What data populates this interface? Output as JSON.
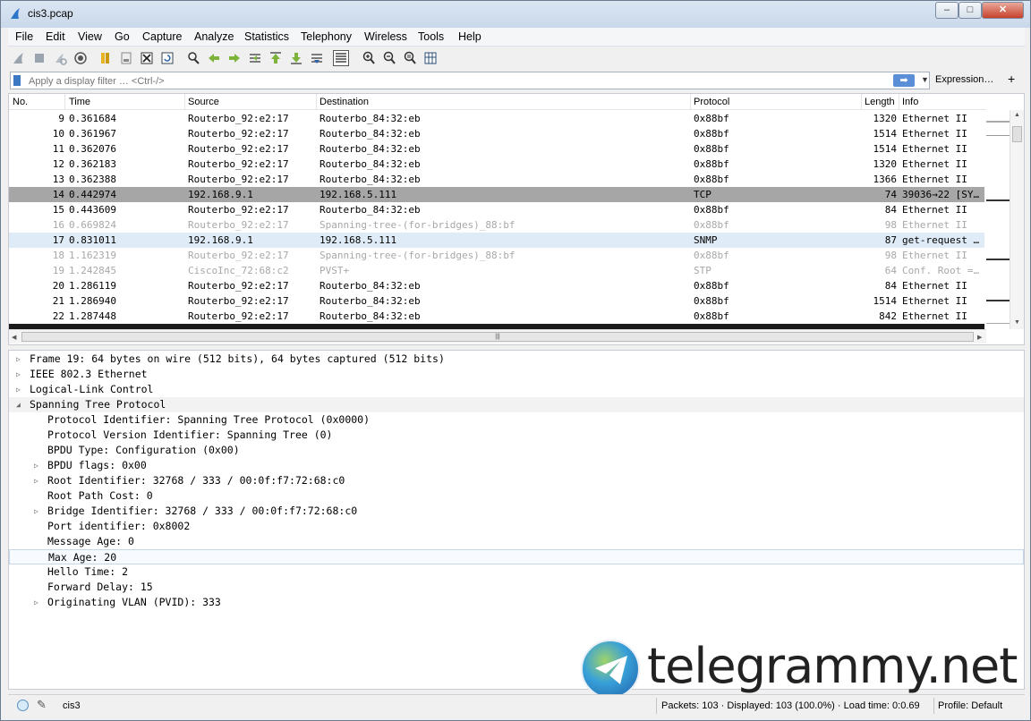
{
  "window": {
    "title": "cis3.pcap",
    "min": "–",
    "max": "□",
    "close": "✕"
  },
  "menu": [
    "File",
    "Edit",
    "View",
    "Go",
    "Capture",
    "Analyze",
    "Statistics",
    "Telephony",
    "Wireless",
    "Tools",
    "Help"
  ],
  "toolbar": {
    "icons": [
      "start-capture-icon",
      "stop-capture-icon",
      "restart-capture-icon",
      "capture-options-icon",
      "open-file-icon",
      "save-file-icon",
      "close-file-icon",
      "reload-file-icon",
      "find-packet-icon",
      "go-back-icon",
      "go-forward-icon",
      "go-to-packet-icon",
      "go-first-icon",
      "go-last-icon",
      "autoscroll-icon",
      "colorize-icon",
      "zoom-in-icon",
      "zoom-out-icon",
      "zoom-normal-icon",
      "resize-columns-icon"
    ]
  },
  "filter": {
    "placeholder": "Apply a display filter … <Ctrl-/>",
    "apply_glyph": "➡",
    "dropdown_glyph": "▼",
    "expression_label": "Expression…",
    "add_glyph": "+"
  },
  "packet_list": {
    "columns": [
      "No.",
      "Time",
      "Source",
      "Destination",
      "Protocol",
      "Length",
      "Info"
    ],
    "rows": [
      {
        "no": "9",
        "time": "0.361684",
        "src": "Routerbo_92:e2:17",
        "dst": "Routerbo_84:32:eb",
        "proto": "0x88bf",
        "len": "1320",
        "info": "Ethernet II",
        "style": "normal"
      },
      {
        "no": "10",
        "time": "0.361967",
        "src": "Routerbo_92:e2:17",
        "dst": "Routerbo_84:32:eb",
        "proto": "0x88bf",
        "len": "1514",
        "info": "Ethernet II",
        "style": "normal"
      },
      {
        "no": "11",
        "time": "0.362076",
        "src": "Routerbo_92:e2:17",
        "dst": "Routerbo_84:32:eb",
        "proto": "0x88bf",
        "len": "1514",
        "info": "Ethernet II",
        "style": "normal"
      },
      {
        "no": "12",
        "time": "0.362183",
        "src": "Routerbo_92:e2:17",
        "dst": "Routerbo_84:32:eb",
        "proto": "0x88bf",
        "len": "1320",
        "info": "Ethernet II",
        "style": "normal"
      },
      {
        "no": "13",
        "time": "0.362388",
        "src": "Routerbo_92:e2:17",
        "dst": "Routerbo_84:32:eb",
        "proto": "0x88bf",
        "len": "1366",
        "info": "Ethernet II",
        "style": "normal"
      },
      {
        "no": "14",
        "time": "0.442974",
        "src": "192.168.9.1",
        "dst": "192.168.5.111",
        "proto": "TCP",
        "len": "74",
        "info": "39036→22 [SY…",
        "style": "selected"
      },
      {
        "no": "15",
        "time": "0.443609",
        "src": "Routerbo_92:e2:17",
        "dst": "Routerbo_84:32:eb",
        "proto": "0x88bf",
        "len": "84",
        "info": "Ethernet II",
        "style": "normal"
      },
      {
        "no": "16",
        "time": "0.669824",
        "src": "Routerbo_92:e2:17",
        "dst": "Spanning-tree-(for-bridges)_88:bf",
        "proto": "0x88bf",
        "len": "98",
        "info": "Ethernet II",
        "style": "faded"
      },
      {
        "no": "17",
        "time": "0.831011",
        "src": "192.168.9.1",
        "dst": "192.168.5.111",
        "proto": "SNMP",
        "len": "87",
        "info": "get-request …",
        "style": "snmp"
      },
      {
        "no": "18",
        "time": "1.162319",
        "src": "Routerbo_92:e2:17",
        "dst": "Spanning-tree-(for-bridges)_88:bf",
        "proto": "0x88bf",
        "len": "98",
        "info": "Ethernet II",
        "style": "faded"
      },
      {
        "no": "19",
        "time": "1.242845",
        "src": "CiscoInc_72:68:c2",
        "dst": "PVST+",
        "proto": "STP",
        "len": "64",
        "info": "Conf. Root =…",
        "style": "faded"
      },
      {
        "no": "20",
        "time": "1.286119",
        "src": "Routerbo_92:e2:17",
        "dst": "Routerbo_84:32:eb",
        "proto": "0x88bf",
        "len": "84",
        "info": "Ethernet II",
        "style": "normal"
      },
      {
        "no": "21",
        "time": "1.286940",
        "src": "Routerbo_92:e2:17",
        "dst": "Routerbo_84:32:eb",
        "proto": "0x88bf",
        "len": "1514",
        "info": "Ethernet II",
        "style": "normal"
      },
      {
        "no": "22",
        "time": "1.287448",
        "src": "Routerbo_92:e2:17",
        "dst": "Routerbo_84:32:eb",
        "proto": "0x88bf",
        "len": "842",
        "info": "Ethernet II",
        "style": "normal"
      }
    ],
    "hscroll_grip": "|||"
  },
  "details": {
    "rows": [
      {
        "text": "Frame 19: 64 bytes on wire (512 bits), 64 bytes captured (512 bits)",
        "level": 0,
        "toggle": "closed"
      },
      {
        "text": "IEEE 802.3 Ethernet",
        "level": 0,
        "toggle": "closed"
      },
      {
        "text": "Logical-Link Control",
        "level": 0,
        "toggle": "closed"
      },
      {
        "text": "Spanning Tree Protocol",
        "level": 0,
        "toggle": "open"
      },
      {
        "text": "Protocol Identifier: Spanning Tree Protocol (0x0000)",
        "level": 1,
        "toggle": "none"
      },
      {
        "text": "Protocol Version Identifier: Spanning Tree (0)",
        "level": 1,
        "toggle": "none"
      },
      {
        "text": "BPDU Type: Configuration (0x00)",
        "level": 1,
        "toggle": "none"
      },
      {
        "text": "BPDU flags: 0x00",
        "level": 1,
        "toggle": "closed"
      },
      {
        "text": "Root Identifier: 32768 / 333 / 00:0f:f7:72:68:c0",
        "level": 1,
        "toggle": "closed"
      },
      {
        "text": "Root Path Cost: 0",
        "level": 1,
        "toggle": "none"
      },
      {
        "text": "Bridge Identifier: 32768 / 333 / 00:0f:f7:72:68:c0",
        "level": 1,
        "toggle": "closed"
      },
      {
        "text": "Port identifier: 0x8002",
        "level": 1,
        "toggle": "none"
      },
      {
        "text": "Message Age: 0",
        "level": 1,
        "toggle": "none"
      },
      {
        "text": "Max Age: 20",
        "level": 1,
        "toggle": "none",
        "focused": true
      },
      {
        "text": "Hello Time: 2",
        "level": 1,
        "toggle": "none"
      },
      {
        "text": "Forward Delay: 15",
        "level": 1,
        "toggle": "none"
      },
      {
        "text": "Originating VLAN (PVID): 333",
        "level": 1,
        "toggle": "closed"
      }
    ]
  },
  "watermark": {
    "text": "telegrammy.net"
  },
  "status": {
    "file": "cis3",
    "stats": "Packets: 103 · Displayed: 103 (100.0%) · Load time: 0:0.69",
    "profile": "Profile: Default"
  },
  "colors": {
    "selected_row": "#a6a6a6",
    "snmp_row": "#dfecf7",
    "faded_text": "#a8a8a8",
    "accent": "#3c78c3"
  }
}
